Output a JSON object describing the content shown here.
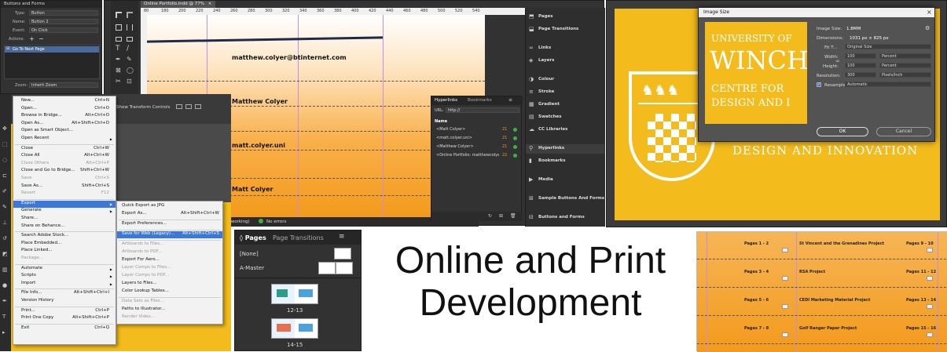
{
  "buttons_panel": {
    "title": "Buttons and Forms",
    "type_label": "Type:",
    "type_value": "Button",
    "name_label": "Name:",
    "name_value": "Button 2",
    "event_label": "Event:",
    "event_value": "On Click",
    "actions_label": "Actions:",
    "action_item": "Go To Next Page",
    "zoom_label": "Zoom:",
    "zoom_value": "Inherit Zoom"
  },
  "document": {
    "tab_title": "Online Portfolio.indd @ 77%",
    "ruler_ticks": [
      "80",
      "180",
      "200",
      "220",
      "240",
      "260",
      "280",
      "300",
      "320",
      "340",
      "360",
      "380",
      "400",
      "420",
      "440",
      "460",
      "480",
      "500",
      "520",
      "540"
    ],
    "lines": [
      "matthew.colyer@btinternet.com",
      "Matthew Colyer",
      "matt.colyer.uni",
      "Matt Colyer"
    ],
    "status_zoom": "[Basic] (working)",
    "status_errors": "No errors"
  },
  "control_bar": {
    "label": "Show Transform Controls"
  },
  "file_menu": {
    "items": [
      {
        "label": "New...",
        "shortcut": "Ctrl+N"
      },
      {
        "label": "Open...",
        "shortcut": "Ctrl+O"
      },
      {
        "label": "Browse in Bridge...",
        "shortcut": "Alt+Ctrl+O"
      },
      {
        "label": "Open As...",
        "shortcut": "Alt+Shift+Ctrl+O"
      },
      {
        "label": "Open as Smart Object...",
        "shortcut": ""
      },
      {
        "label": "Open Recent",
        "shortcut": ""
      },
      {
        "label": "Close",
        "shortcut": "Ctrl+W"
      },
      {
        "label": "Close All",
        "shortcut": "Alt+Ctrl+W"
      },
      {
        "label": "Close Others",
        "shortcut": "Alt+Ctrl+P"
      },
      {
        "label": "Close and Go to Bridge...",
        "shortcut": "Shift+Ctrl+W"
      },
      {
        "label": "Save",
        "shortcut": "Ctrl+S"
      },
      {
        "label": "Save As...",
        "shortcut": "Shift+Ctrl+S"
      },
      {
        "label": "Revert",
        "shortcut": "F12"
      },
      {
        "label": "Export",
        "shortcut": ""
      },
      {
        "label": "Generate",
        "shortcut": ""
      },
      {
        "label": "Share...",
        "shortcut": ""
      },
      {
        "label": "Share on Behance...",
        "shortcut": ""
      },
      {
        "label": "Search Adobe Stock...",
        "shortcut": ""
      },
      {
        "label": "Place Embedded...",
        "shortcut": ""
      },
      {
        "label": "Place Linked...",
        "shortcut": ""
      },
      {
        "label": "Package...",
        "shortcut": ""
      },
      {
        "label": "Automate",
        "shortcut": ""
      },
      {
        "label": "Scripts",
        "shortcut": ""
      },
      {
        "label": "Import",
        "shortcut": ""
      },
      {
        "label": "File Info...",
        "shortcut": "Alt+Shift+Ctrl+I"
      },
      {
        "label": "Version History",
        "shortcut": ""
      },
      {
        "label": "Print...",
        "shortcut": "Ctrl+P"
      },
      {
        "label": "Print One Copy",
        "shortcut": "Alt+Shift+Ctrl+P"
      },
      {
        "label": "Exit",
        "shortcut": "Ctrl+Q"
      }
    ]
  },
  "export_submenu": {
    "items": [
      {
        "label": "Quick Export as JPG",
        "shortcut": ""
      },
      {
        "label": "Export As...",
        "shortcut": "Alt+Shift+Ctrl+W"
      },
      {
        "label": "Export Preferences...",
        "shortcut": ""
      },
      {
        "label": "Save for Web (Legacy)...",
        "shortcut": "Alt+Shift+Ctrl+S"
      },
      {
        "label": "Artboards to Files...",
        "shortcut": ""
      },
      {
        "label": "Artboards to PDF...",
        "shortcut": ""
      },
      {
        "label": "Export For Aero...",
        "shortcut": ""
      },
      {
        "label": "Layer Comps to Files...",
        "shortcut": ""
      },
      {
        "label": "Layer Comps to PDF...",
        "shortcut": ""
      },
      {
        "label": "Layers to Files...",
        "shortcut": ""
      },
      {
        "label": "Color Lookup Tables...",
        "shortcut": ""
      },
      {
        "label": "Data Sets as Files...",
        "shortcut": ""
      },
      {
        "label": "Paths to Illustrator...",
        "shortcut": ""
      },
      {
        "label": "Render Video...",
        "shortcut": ""
      }
    ]
  },
  "hyperlinks_panel": {
    "tab1": "Hyperlinks",
    "tab2": "Bookmarks",
    "url_label": "URL:",
    "url_value": "http://",
    "col_name": "Name",
    "rows": [
      {
        "name": "<Matt Colyer>",
        "page": "21"
      },
      {
        "name": "<matt.colyer.uni>",
        "page": "21"
      },
      {
        "name": "<Matthew Colyer>",
        "page": "21"
      },
      {
        "name": "<Online Portfolio: matthewcolyer ...",
        "page": "22"
      }
    ]
  },
  "side_panels": {
    "items": [
      "Pages",
      "Page Transitions",
      "Links",
      "Layers",
      "Colour",
      "Stroke",
      "Gradient",
      "Swatches",
      "CC Libraries",
      "Hyperlinks",
      "Bookmarks",
      "Media",
      "Sample Buttons And Forms",
      "Buttons and Forms"
    ]
  },
  "image_size": {
    "title": "Image Size",
    "logo_line1": "UNIVERSITY OF",
    "logo_line2": "WINCH",
    "logo_line3": "CENTRE FOR",
    "logo_line4": "DESIGN AND I",
    "bg_text": "DESIGN AND INNOVATION",
    "image_size_label": "Image Size:",
    "image_size_value": "1.8MM",
    "dimensions_label": "Dimensions:",
    "dimensions_value": "1031 px × 825 px",
    "fit_label": "Fit T...",
    "fit_value": "Original Size",
    "width_label": "Width:",
    "width_value": "100",
    "width_unit": "Percent",
    "height_label": "Height:",
    "height_value": "100",
    "height_unit": "Percent",
    "resolution_label": "Resolution:",
    "resolution_value": "300",
    "resolution_unit": "Pixels/Inch",
    "resample_label": "Resample:",
    "resample_value": "Automatic",
    "ok": "OK",
    "cancel": "Cancel"
  },
  "pages_panel": {
    "tab1": "Pages",
    "tab2": "Page Transitions",
    "none_label": "[None]",
    "master_label": "A-Master",
    "spread1": "12-13",
    "spread2": "14-15"
  },
  "headline": {
    "line1": "Online and Print",
    "line2": "Development"
  },
  "spreads": {
    "rows": [
      {
        "left": "Pages 1 - 2",
        "mid": "St Vincent and the Grenadines Project",
        "right": "Pages 9 - 10"
      },
      {
        "left": "Pages 3 - 4",
        "mid": "RSA Project",
        "right": "Pages 11 - 12"
      },
      {
        "left": "Pages 5 - 6",
        "mid": "CEDI Marketing Material Project",
        "right": "Pages 13 - 14"
      },
      {
        "left": "Pages 7 - 8",
        "mid": "Golf Ranger Paper Project",
        "right": "Pages 15 - 16"
      }
    ]
  },
  "colors": {
    "accent_orange": "#f39a1c",
    "winchester_yellow": "#f3bb1b",
    "menu_highlight": "#3b78d8"
  }
}
